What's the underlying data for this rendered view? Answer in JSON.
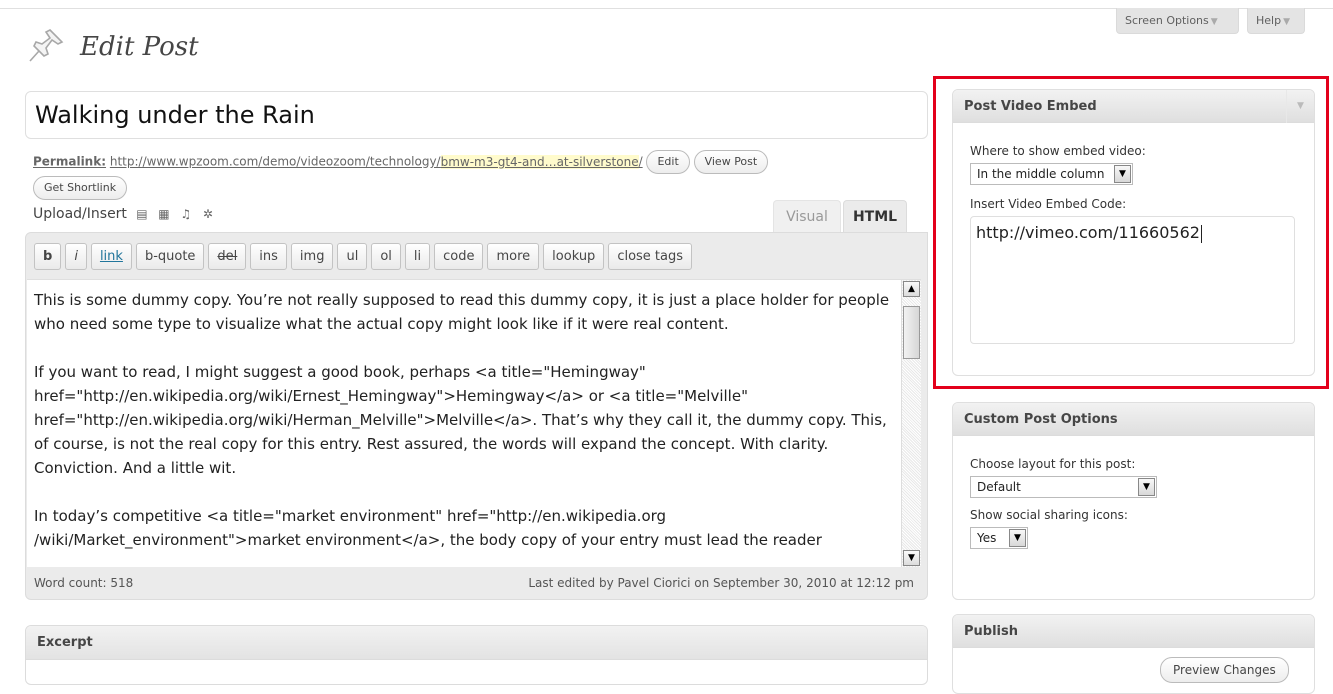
{
  "screen_tabs": {
    "screen_options": "Screen Options",
    "help": "Help"
  },
  "page": {
    "title": "Edit Post"
  },
  "post": {
    "title": "Walking under the Rain"
  },
  "permalink": {
    "label": "Permalink:",
    "base_url": "http://www.wpzoom.com/demo/videozoom/technology/",
    "slug": "bmw-m3-gt4-and…at-silverstone",
    "trailing": "/",
    "edit": "Edit",
    "view": "View Post",
    "shortlink": "Get Shortlink"
  },
  "upload": {
    "label": "Upload/Insert"
  },
  "editor_tabs": {
    "visual": "Visual",
    "html": "HTML"
  },
  "quicktags": [
    "b",
    "i",
    "link",
    "b-quote",
    "del",
    "ins",
    "img",
    "ul",
    "ol",
    "li",
    "code",
    "more",
    "lookup",
    "close tags"
  ],
  "content": {
    "paragraphs": [
      "This is some dummy copy. You’re not really supposed to read this dummy copy, it is just a place holder for people who need some type to visualize what the actual copy might look like if it were real content.",
      "If you want to read, I might suggest a good book, perhaps <a title=\"Hemingway\" href=\"http://en.wikipedia.org/wiki/Ernest_Hemingway\">Hemingway</a> or <a title=\"Melville\" href=\"http://en.wikipedia.org/wiki/Herman_Melville\">Melville</a>. That’s why they call it, the dummy copy. This, of course, is not the real copy for this entry. Rest assured, the words will expand the concept. With clarity. Conviction. And a little wit.",
      "In today’s competitive <a title=\"market environment\" href=\"http://en.wikipedia.org /wiki/Market_environment\">market environment</a>, the body copy of your entry must lead the reader"
    ]
  },
  "status": {
    "word_count": "Word count: 518",
    "last_edited": "Last edited by Pavel Ciorici on September 30, 2010 at 12:12 pm"
  },
  "excerpt": {
    "title": "Excerpt"
  },
  "video_box": {
    "title": "Post Video Embed",
    "where_label": "Where to show embed video:",
    "where_value": "In the middle column",
    "code_label": "Insert Video Embed Code:",
    "code_value": "http://vimeo.com/11660562"
  },
  "custom_box": {
    "title": "Custom Post Options",
    "layout_label": "Choose layout for this post:",
    "layout_value": "Default",
    "social_label": "Show social sharing icons:",
    "social_value": "Yes"
  },
  "publish_box": {
    "title": "Publish",
    "preview": "Preview Changes"
  },
  "colors": {
    "highlight": "#e3001b",
    "link": "#21759b",
    "slug_bg": "#fffbcc"
  }
}
